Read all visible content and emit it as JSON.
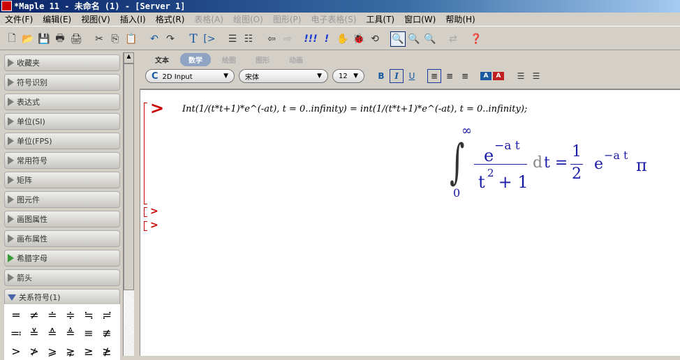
{
  "title": "*Maple 11 - 未命名 (1) - [Server 1]",
  "menu": [
    "文件(F)",
    "编辑(E)",
    "视图(V)",
    "插入(I)",
    "格式(R)",
    "表格(A)",
    "绘图(O)",
    "图形(P)",
    "电子表格(S)",
    "工具(T)",
    "窗口(W)",
    "帮助(H)"
  ],
  "palette": {
    "items": [
      "收藏夹",
      "符号识别",
      "表达式",
      "单位(SI)",
      "单位(FPS)",
      "常用符号",
      "矩阵",
      "图元件",
      "画图属性",
      "画布属性",
      "希腊字母",
      "箭头"
    ],
    "expanded": "关系符号(1)",
    "symbols": [
      "=",
      "≠",
      "≐",
      "≑",
      "≒",
      "≓",
      "≕",
      "≚",
      "≙",
      "≜",
      "≡",
      "≢",
      ">",
      "≯",
      "⩾",
      "⋧",
      "≥",
      "≱"
    ]
  },
  "context": {
    "tabs": [
      "文本",
      "数学",
      "绘图",
      "图形",
      "动画"
    ],
    "mode": "2D Input",
    "mode_icon": "C",
    "font": "宋体",
    "size": "12",
    "bold": "B",
    "italic": "I",
    "underline": "U"
  },
  "doc": {
    "prompt": ">",
    "input": "Int(1/(t*t+1)*e^(-at), t = 0..infinity) = int(1/(t*t+1)*e^(-at), t = 0..infinity);",
    "output": {
      "upper": "∞",
      "lower": "0",
      "num": "e",
      "num_exp": "−a t",
      "den": "t",
      "den_exp": "2",
      "den_rest": " + 1",
      "dt": "d",
      "t": "t =",
      "half_num": "1",
      "half_den": "2",
      "e": "e",
      "e_exp": "−a t",
      "pi": "π"
    }
  }
}
